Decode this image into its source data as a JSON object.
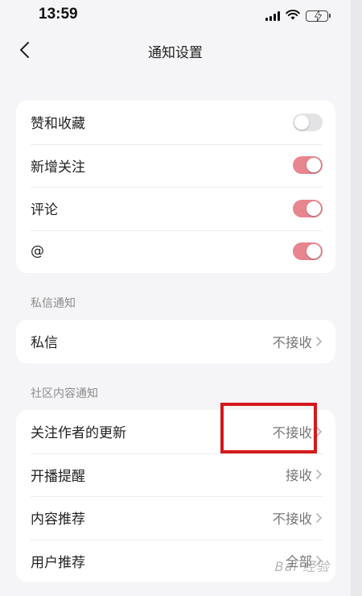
{
  "status_bar": {
    "time": "13:59"
  },
  "nav": {
    "title": "通知设置"
  },
  "interactions": [
    {
      "label": "赞和收藏",
      "enabled": false
    },
    {
      "label": "新增关注",
      "enabled": true
    },
    {
      "label": "评论",
      "enabled": true
    },
    {
      "label": "@",
      "enabled": true
    }
  ],
  "private_section": {
    "header": "私信通知",
    "items": [
      {
        "label": "私信",
        "value": "不接收"
      }
    ]
  },
  "community_section": {
    "header": "社区内容通知",
    "items": [
      {
        "label": "关注作者的更新",
        "value": "不接收"
      },
      {
        "label": "开播提醒",
        "value": "接收"
      },
      {
        "label": "内容推荐",
        "value": "不接收"
      },
      {
        "label": "用户推荐",
        "value": "全部"
      }
    ]
  },
  "colors": {
    "toggle_on": "#e88690",
    "toggle_off": "#e3e3e5",
    "highlight": "#d4191e"
  },
  "watermark": "Bai 经验"
}
